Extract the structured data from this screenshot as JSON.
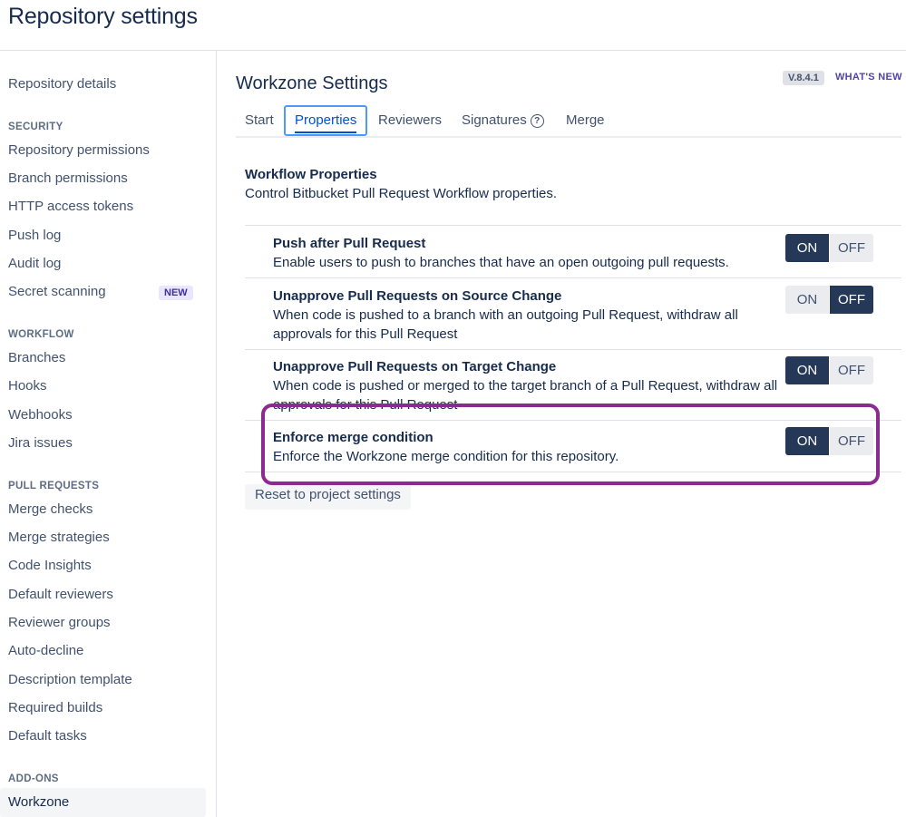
{
  "page": {
    "title": "Repository settings"
  },
  "sidebar": {
    "repo_details": "Repository details",
    "security_heading": "SECURITY",
    "security_items": [
      "Repository permissions",
      "Branch permissions",
      "HTTP access tokens",
      "Push log",
      "Audit log",
      "Secret scanning"
    ],
    "new_badge": "NEW",
    "workflow_heading": "WORKFLOW",
    "workflow_items": [
      "Branches",
      "Hooks",
      "Webhooks",
      "Jira issues"
    ],
    "pull_requests_heading": "PULL REQUESTS",
    "pull_requests_items": [
      "Merge checks",
      "Merge strategies",
      "Code Insights",
      "Default reviewers",
      "Reviewer groups",
      "Auto-decline",
      "Description template",
      "Required builds",
      "Default tasks"
    ],
    "addons_heading": "ADD-ONS",
    "addons_items": [
      "Workzone"
    ],
    "selected": "Workzone"
  },
  "main": {
    "title": "Workzone Settings",
    "version": "V.8.4.1",
    "whats_new": "WHAT'S NEW",
    "tabs": [
      {
        "label": "Start",
        "active": false
      },
      {
        "label": "Properties",
        "active": true
      },
      {
        "label": "Reviewers",
        "active": false
      },
      {
        "label": "Signatures",
        "active": false,
        "icon": "help-circle-icon"
      },
      {
        "label": "Merge",
        "active": false
      }
    ],
    "help_glyph": "?",
    "workflow_title": "Workflow Properties",
    "workflow_desc": "Control Bitbucket Pull Request Workflow properties.",
    "properties": [
      {
        "title": "Push after Pull Request",
        "desc": "Enable users to push to branches that have an open outgoing pull requests.",
        "value": "ON"
      },
      {
        "title": "Unapprove Pull Requests on Source Change",
        "desc": "When code is pushed to a branch with an outgoing Pull Request, withdraw all approvals for this Pull Request",
        "value": "OFF"
      },
      {
        "title": "Unapprove Pull Requests on Target Change",
        "desc": "When code is pushed or merged to the target branch of a Pull Request, withdraw all approvals for this Pull Request",
        "value": "ON"
      },
      {
        "title": "Enforce merge condition",
        "desc": "Enforce the Workzone merge condition for this repository.",
        "value": "ON"
      }
    ],
    "toggle_on": "ON",
    "toggle_off": "OFF",
    "reset_button": "Reset to project settings"
  },
  "colors": {
    "highlight": "#8b2a8f",
    "toggle_active": "#253858",
    "tab_active": "#0052cc"
  }
}
